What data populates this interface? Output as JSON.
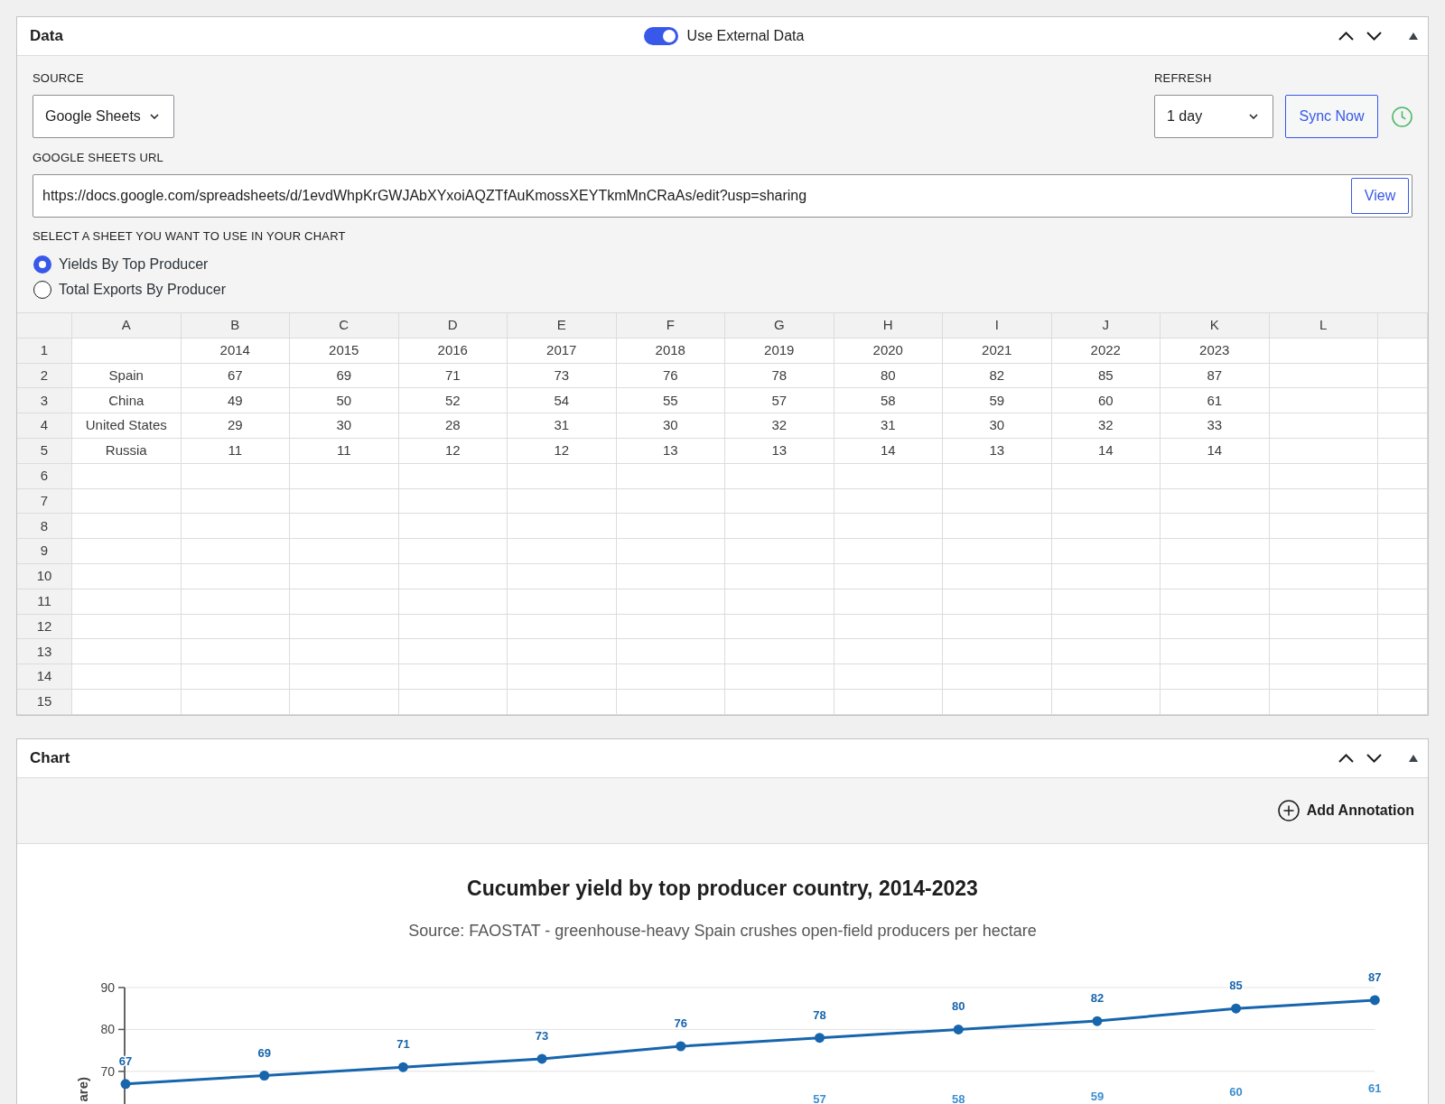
{
  "data_panel": {
    "title": "Data",
    "toggle": {
      "label": "Use External Data",
      "on": true
    },
    "source": {
      "label": "SOURCE",
      "value": "Google Sheets"
    },
    "refresh": {
      "label": "REFRESH",
      "value": "1 day"
    },
    "sync_button": "Sync Now",
    "sheets_url": {
      "label": "GOOGLE SHEETS URL",
      "value": "https://docs.google.com/spreadsheets/d/1evdWhpKrGWJAbXYxoiAQZTfAuKmossXEYTkmMnCRaAs/edit?usp=sharing",
      "button": "View"
    },
    "sheet_select": {
      "label": "SELECT A SHEET YOU WANT TO USE IN YOUR CHART",
      "options": [
        {
          "label": "Yields By Top Producer",
          "selected": true
        },
        {
          "label": "Total Exports By Producer",
          "selected": false
        }
      ]
    },
    "table": {
      "columns": [
        "A",
        "B",
        "C",
        "D",
        "E",
        "F",
        "G",
        "H",
        "I",
        "J",
        "K",
        "L"
      ],
      "rows": [
        {
          "number": "1",
          "cells": [
            null,
            "2014",
            "2015",
            "2016",
            "2017",
            "2018",
            "2019",
            "2020",
            "2021",
            "2022",
            "2023"
          ]
        },
        {
          "number": "2",
          "cells": [
            "Spain",
            "67",
            "69",
            "71",
            "73",
            "76",
            "78",
            "80",
            "82",
            "85",
            "87"
          ]
        },
        {
          "number": "3",
          "cells": [
            "China",
            "49",
            "50",
            "52",
            "54",
            "55",
            "57",
            "58",
            "59",
            "60",
            "61"
          ]
        },
        {
          "number": "4",
          "cells": [
            "United States",
            "29",
            "30",
            "28",
            "31",
            "30",
            "32",
            "31",
            "30",
            "32",
            "33"
          ]
        },
        {
          "number": "5",
          "cells": [
            "Russia",
            "11",
            "11",
            "12",
            "12",
            "13",
            "13",
            "14",
            "13",
            "14",
            "14"
          ]
        },
        {
          "number": "6"
        },
        {
          "number": "7"
        },
        {
          "number": "8"
        },
        {
          "number": "9"
        },
        {
          "number": "10"
        },
        {
          "number": "11"
        },
        {
          "number": "12"
        },
        {
          "number": "13"
        },
        {
          "number": "14"
        },
        {
          "number": "15"
        }
      ]
    }
  },
  "chart_panel": {
    "title": "Chart",
    "add_annotation": "Add Annotation",
    "chart": {
      "subtitle": "Source: FAOSTAT - greenhouse-heavy Spain crushes open-field producers per hectare",
      "chart_data": {
        "type": "line",
        "title": "Cucumber yield by top producer country, 2014-2023",
        "ylabel": "are)",
        "ylim": [
          62,
          90
        ],
        "yticks": [
          70,
          80,
          90
        ],
        "data_labels": true,
        "series": [
          {
            "color": "#1765ad",
            "marker": "circle",
            "values": [
              67,
              69,
              71,
              73,
              76,
              78,
              80,
              82,
              85,
              87
            ]
          }
        ]
      },
      "second_series_labels": {
        "color": "#3a8fd0",
        "labels": [
          "57",
          "58",
          "59",
          "60",
          "61"
        ]
      }
    }
  }
}
